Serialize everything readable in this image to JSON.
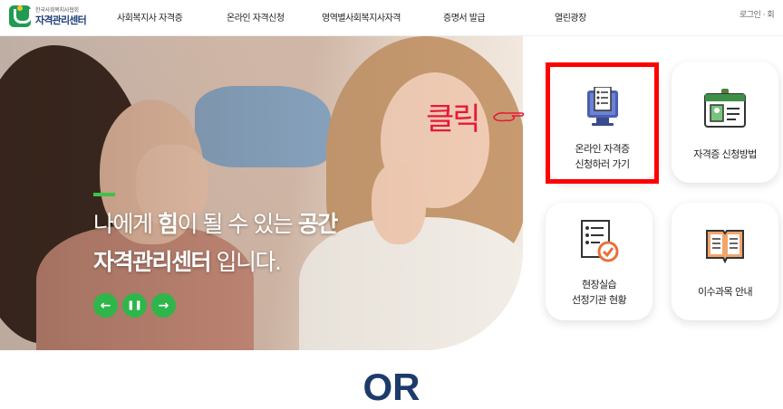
{
  "header": {
    "logo_small": "한국사회복지사협회",
    "logo_big": "자격관리센터",
    "nav": [
      "사회복지사 자격증",
      "온라인 자격신청",
      "영역별사회복지사자격",
      "증명서 발급",
      "열린광장"
    ],
    "login": "로그인 · 회"
  },
  "hero": {
    "line1_a": "나에게 ",
    "line1_b": "힘",
    "line1_c": "이 될 수 있는 ",
    "line1_d": "공간",
    "line2_a": "자격관리센터",
    "line2_b": " 입니다.",
    "controls": {
      "prev": "←",
      "pause": "❚❚",
      "next": "→"
    }
  },
  "cards": [
    {
      "line1": "온라인 자격증",
      "line2": "신청하러 가기",
      "icon": "monitor-document-icon"
    },
    {
      "line1": "자격증 신청방법",
      "line2": "",
      "icon": "id-card-icon"
    },
    {
      "line1": "현장실습",
      "line2": "선정기관 현황",
      "icon": "checklist-icon"
    },
    {
      "line1": "이수과목 안내",
      "line2": "",
      "icon": "open-book-icon"
    }
  ],
  "annotation": {
    "click_text": "클릭",
    "highlight_color": "#ff0000",
    "text_color": "#e8183a"
  },
  "footer_text": "OR",
  "colors": {
    "brand_green": "#2fb64a",
    "brand_navy": "#1d3a6b"
  }
}
